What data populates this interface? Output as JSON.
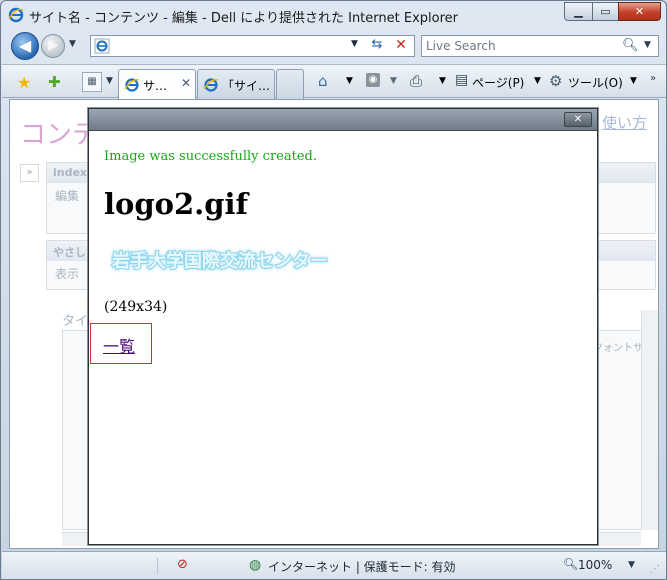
{
  "window": {
    "title": "サイト名 - コンテンツ - 編集 - Dell により提供された Internet Explorer",
    "minimize_glyph": "▁",
    "maximize_glyph": "▭",
    "close_glyph": "✕"
  },
  "address": {
    "value": "",
    "dropdown_glyph": "▼",
    "refresh_glyph": "⇆",
    "stop_glyph": "✕"
  },
  "search": {
    "placeholder": "Live Search",
    "dropdown_glyph": "▼"
  },
  "nav": {
    "back_glyph": "◀",
    "forward_glyph": "▶",
    "history_glyph": "▼"
  },
  "tabs": [
    {
      "label": "サ…",
      "close": "✕"
    },
    {
      "label": "「サイ…"
    }
  ],
  "commandbar": {
    "page_label": "ページ(P)",
    "tools_label": "ツール(O)",
    "drop_glyph": "▼",
    "more_glyph": "»"
  },
  "background_page": {
    "title": "コンテ",
    "usage_link": "使い方",
    "sidebar_toggle": "»",
    "box1_heading": "index",
    "box1_sub": "編集",
    "box2_heading": "やさしい",
    "box2_sub": "表示",
    "editor_label": "タイ",
    "font_size_label": "フォントサ"
  },
  "dialog": {
    "close_glyph": "✕",
    "success_message": "Image was successfully created.",
    "file_name": "logo2.gif",
    "logo_text": "岩手大学国際交流センター",
    "image_dimensions": "(249x34)",
    "list_link": "一覧"
  },
  "statusbar": {
    "zone_text": "インターネット | 保護モード: 有効",
    "zoom_level": "100%",
    "zoom_drop_glyph": "▼"
  },
  "colors": {
    "success_green": "#15a815",
    "link_purple": "#4b0a7a",
    "focus_red": "#d23030",
    "logo_cyan": "#8fd6ec"
  }
}
